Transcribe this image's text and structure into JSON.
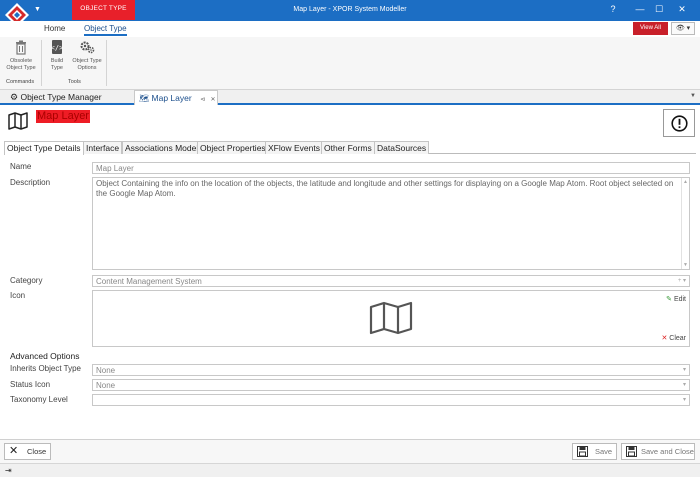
{
  "window": {
    "title": "Map Layer - XPOR System Modeller",
    "context_tab": "OBJECT TYPE",
    "controls": [
      "?",
      "—",
      "☐",
      "✕"
    ]
  },
  "ribbon": {
    "tabs": [
      {
        "label": "Home",
        "active": false
      },
      {
        "label": "Object Type",
        "active": true
      }
    ],
    "view_all": "View All",
    "eye_menu": "👁 ▾",
    "groups": [
      {
        "label": "Commands",
        "buttons": [
          {
            "label": "Obsolete Object Type",
            "icon": "trash-icon"
          }
        ]
      },
      {
        "label": "Tools",
        "buttons": [
          {
            "label": "Build Type",
            "icon": "code-file-icon"
          },
          {
            "label": "Object Type Options",
            "icon": "gears-icon"
          }
        ]
      }
    ]
  },
  "document_tabs": [
    {
      "label": "Object Type Manager",
      "icon": "gears-icon",
      "active": false
    },
    {
      "label": "Map Layer",
      "icon": "map-icon",
      "active": true
    }
  ],
  "page": {
    "title": "Map Layer",
    "icon": "map-icon"
  },
  "inner_tabs": [
    {
      "label": "Object Type Details",
      "active": true
    },
    {
      "label": "Interface",
      "active": false
    },
    {
      "label": "Associations Model",
      "active": false
    },
    {
      "label": "Object Properties",
      "active": false
    },
    {
      "label": "XFlow Events",
      "active": false
    },
    {
      "label": "Other Forms",
      "active": false
    },
    {
      "label": "DataSources",
      "active": false
    }
  ],
  "form": {
    "name_label": "Name",
    "name_value": "Map Layer",
    "description_label": "Description",
    "description_value": "Object Containing the info on the location of the objects, the latitude and longitude and other settings for displaying on a Google Map Atom. Root object selected on the Google Map Atom.",
    "category_label": "Category",
    "category_value": "Content Management System",
    "icon_label": "Icon",
    "icon_edit": "Edit",
    "icon_clear": "Clear",
    "advanced_title": "Advanced Options",
    "inherits_label": "Inherits Object Type",
    "inherits_value": "None",
    "status_icon_label": "Status Icon",
    "status_icon_value": "None",
    "taxonomy_label": "Taxonomy Level",
    "taxonomy_value": ""
  },
  "footer": {
    "close": "Close",
    "save": "Save",
    "save_and_close": "Save and Close"
  },
  "colors": {
    "title_bar": "#1c6ec4",
    "context_red": "#e8202a",
    "accent_blue": "#1c6ec4"
  }
}
